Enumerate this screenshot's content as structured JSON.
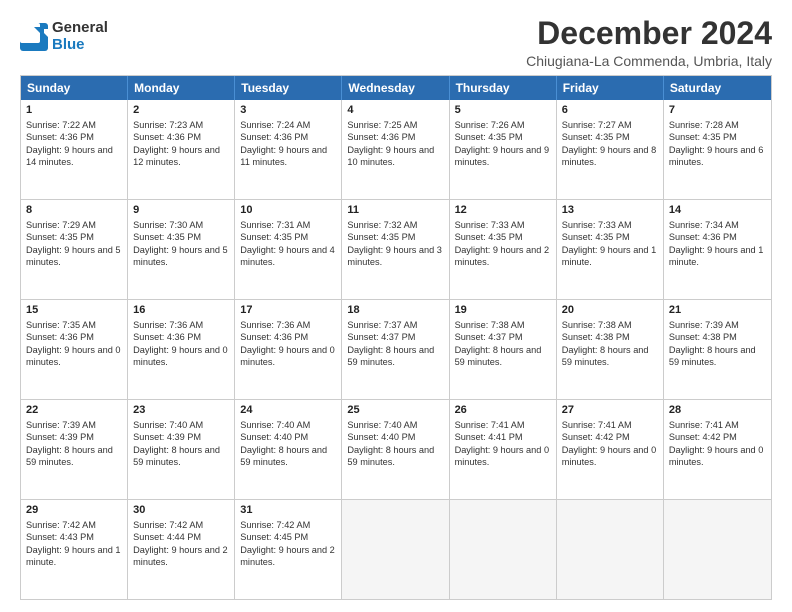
{
  "logo": {
    "general": "General",
    "blue": "Blue"
  },
  "header": {
    "month": "December 2024",
    "location": "Chiugiana-La Commenda, Umbria, Italy"
  },
  "days": [
    "Sunday",
    "Monday",
    "Tuesday",
    "Wednesday",
    "Thursday",
    "Friday",
    "Saturday"
  ],
  "weeks": [
    [
      {
        "day": "1",
        "sunrise": "7:22 AM",
        "sunset": "4:36 PM",
        "daylight": "9 hours and 14 minutes."
      },
      {
        "day": "2",
        "sunrise": "7:23 AM",
        "sunset": "4:36 PM",
        "daylight": "9 hours and 12 minutes."
      },
      {
        "day": "3",
        "sunrise": "7:24 AM",
        "sunset": "4:36 PM",
        "daylight": "9 hours and 11 minutes."
      },
      {
        "day": "4",
        "sunrise": "7:25 AM",
        "sunset": "4:36 PM",
        "daylight": "9 hours and 10 minutes."
      },
      {
        "day": "5",
        "sunrise": "7:26 AM",
        "sunset": "4:35 PM",
        "daylight": "9 hours and 9 minutes."
      },
      {
        "day": "6",
        "sunrise": "7:27 AM",
        "sunset": "4:35 PM",
        "daylight": "9 hours and 8 minutes."
      },
      {
        "day": "7",
        "sunrise": "7:28 AM",
        "sunset": "4:35 PM",
        "daylight": "9 hours and 6 minutes."
      }
    ],
    [
      {
        "day": "8",
        "sunrise": "7:29 AM",
        "sunset": "4:35 PM",
        "daylight": "9 hours and 5 minutes."
      },
      {
        "day": "9",
        "sunrise": "7:30 AM",
        "sunset": "4:35 PM",
        "daylight": "9 hours and 5 minutes."
      },
      {
        "day": "10",
        "sunrise": "7:31 AM",
        "sunset": "4:35 PM",
        "daylight": "9 hours and 4 minutes."
      },
      {
        "day": "11",
        "sunrise": "7:32 AM",
        "sunset": "4:35 PM",
        "daylight": "9 hours and 3 minutes."
      },
      {
        "day": "12",
        "sunrise": "7:33 AM",
        "sunset": "4:35 PM",
        "daylight": "9 hours and 2 minutes."
      },
      {
        "day": "13",
        "sunrise": "7:33 AM",
        "sunset": "4:35 PM",
        "daylight": "9 hours and 1 minute."
      },
      {
        "day": "14",
        "sunrise": "7:34 AM",
        "sunset": "4:36 PM",
        "daylight": "9 hours and 1 minute."
      }
    ],
    [
      {
        "day": "15",
        "sunrise": "7:35 AM",
        "sunset": "4:36 PM",
        "daylight": "9 hours and 0 minutes."
      },
      {
        "day": "16",
        "sunrise": "7:36 AM",
        "sunset": "4:36 PM",
        "daylight": "9 hours and 0 minutes."
      },
      {
        "day": "17",
        "sunrise": "7:36 AM",
        "sunset": "4:36 PM",
        "daylight": "9 hours and 0 minutes."
      },
      {
        "day": "18",
        "sunrise": "7:37 AM",
        "sunset": "4:37 PM",
        "daylight": "8 hours and 59 minutes."
      },
      {
        "day": "19",
        "sunrise": "7:38 AM",
        "sunset": "4:37 PM",
        "daylight": "8 hours and 59 minutes."
      },
      {
        "day": "20",
        "sunrise": "7:38 AM",
        "sunset": "4:38 PM",
        "daylight": "8 hours and 59 minutes."
      },
      {
        "day": "21",
        "sunrise": "7:39 AM",
        "sunset": "4:38 PM",
        "daylight": "8 hours and 59 minutes."
      }
    ],
    [
      {
        "day": "22",
        "sunrise": "7:39 AM",
        "sunset": "4:39 PM",
        "daylight": "8 hours and 59 minutes."
      },
      {
        "day": "23",
        "sunrise": "7:40 AM",
        "sunset": "4:39 PM",
        "daylight": "8 hours and 59 minutes."
      },
      {
        "day": "24",
        "sunrise": "7:40 AM",
        "sunset": "4:40 PM",
        "daylight": "8 hours and 59 minutes."
      },
      {
        "day": "25",
        "sunrise": "7:40 AM",
        "sunset": "4:40 PM",
        "daylight": "8 hours and 59 minutes."
      },
      {
        "day": "26",
        "sunrise": "7:41 AM",
        "sunset": "4:41 PM",
        "daylight": "9 hours and 0 minutes."
      },
      {
        "day": "27",
        "sunrise": "7:41 AM",
        "sunset": "4:42 PM",
        "daylight": "9 hours and 0 minutes."
      },
      {
        "day": "28",
        "sunrise": "7:41 AM",
        "sunset": "4:42 PM",
        "daylight": "9 hours and 0 minutes."
      }
    ],
    [
      {
        "day": "29",
        "sunrise": "7:42 AM",
        "sunset": "4:43 PM",
        "daylight": "9 hours and 1 minute."
      },
      {
        "day": "30",
        "sunrise": "7:42 AM",
        "sunset": "4:44 PM",
        "daylight": "9 hours and 2 minutes."
      },
      {
        "day": "31",
        "sunrise": "7:42 AM",
        "sunset": "4:45 PM",
        "daylight": "9 hours and 2 minutes."
      },
      null,
      null,
      null,
      null
    ]
  ]
}
